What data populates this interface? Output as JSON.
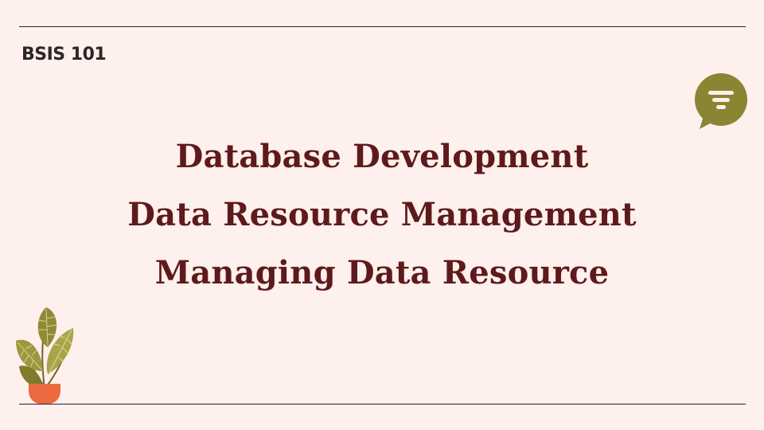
{
  "slide": {
    "course_code": "BSIS 101",
    "title_lines": [
      "Database Development",
      "Data Resource Management",
      "Managing Data Resource"
    ]
  },
  "icons": {
    "chat": "filter-chat-bubble-icon",
    "plant": "potted-plant-illustration"
  },
  "colors": {
    "background": "#fdf0ed",
    "title": "#5e1a1b",
    "accent_olive": "#8a8532",
    "pot": "#ec6a3f",
    "rules": "#2b2424"
  }
}
